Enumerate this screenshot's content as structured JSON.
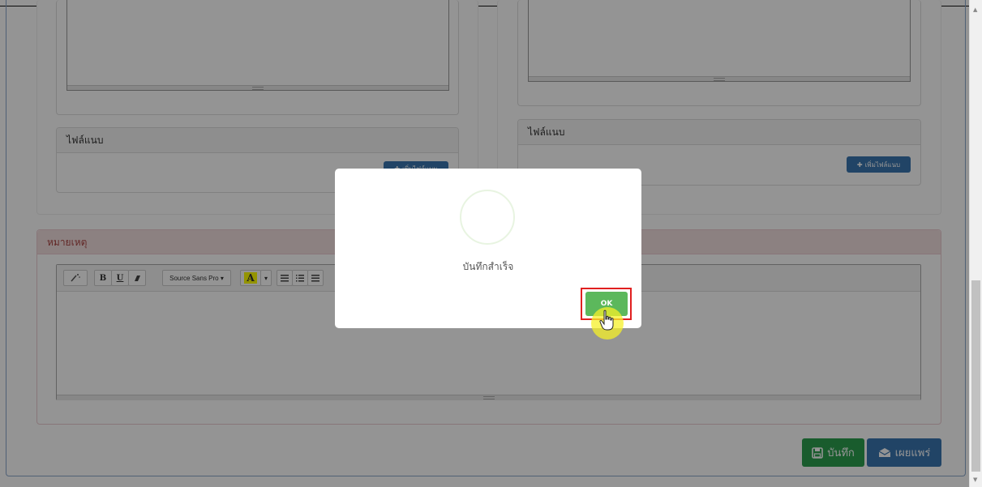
{
  "left_attach": {
    "title": "ไฟล์แนบ",
    "button_label": "เพิ่มไฟล์แนบ"
  },
  "right_attach": {
    "title": "ไฟล์แนบ",
    "button_label": "เพิ่มไฟล์แนบ"
  },
  "remark": {
    "title": "หมายเหตุ",
    "toolbar": {
      "bold": "B",
      "underline": "U",
      "font_label": "Source Sans Pro ▾",
      "color_letter": "A",
      "caret": "▾"
    }
  },
  "modal": {
    "message": "บันทึกสำเร็จ",
    "ok_label": "OK"
  },
  "actions": {
    "save_label": "บันทึก",
    "publish_label": "เผยแพร่",
    "save_color": "#2b9f4f",
    "publish_color": "#3a76b0"
  },
  "icons": {
    "magic": "magic-wand-icon",
    "eraser": "eraser-icon",
    "list": "list-icon",
    "plus": "plus-icon",
    "floppy": "floppy-disk-icon",
    "envelope": "envelope-open-icon",
    "hand": "hand-pointer-icon"
  }
}
